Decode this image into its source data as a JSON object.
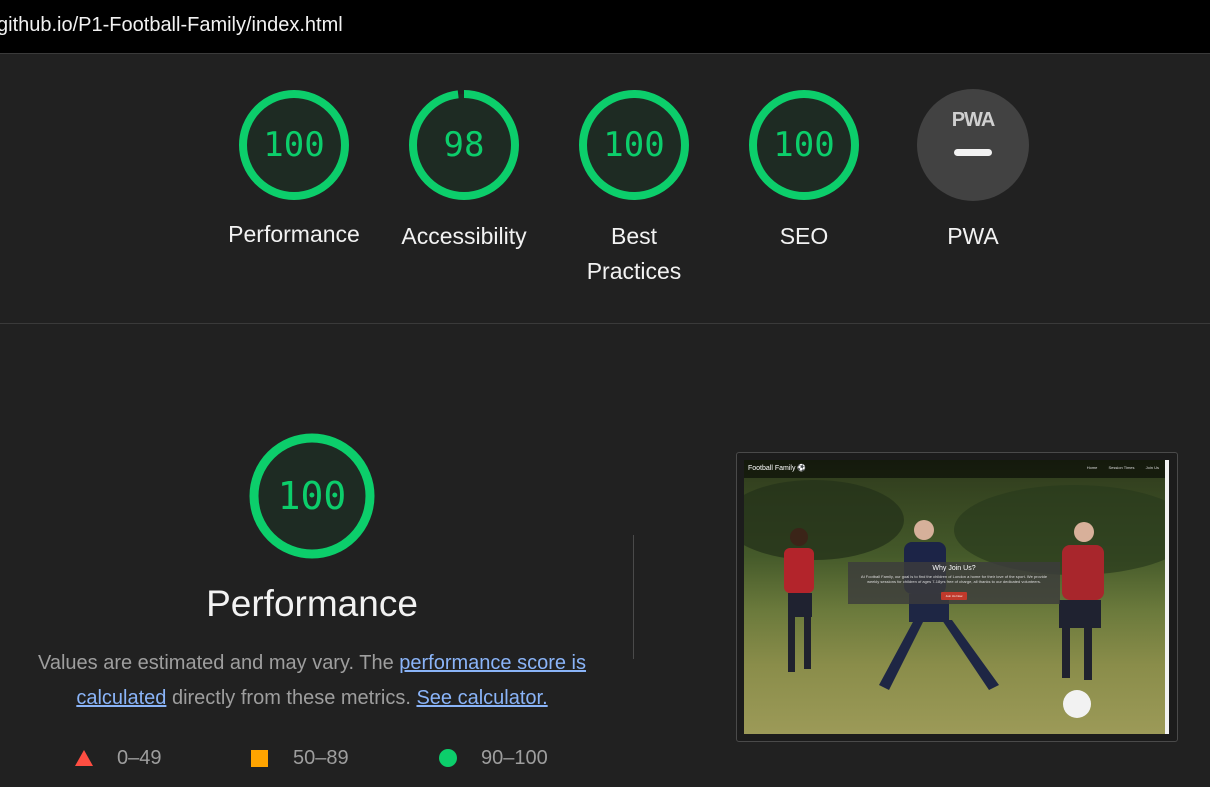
{
  "url": "github.io/P1-Football-Family/index.html",
  "colors": {
    "pass": "#0cce6b",
    "average": "#ffa400",
    "fail": "#ff4e42",
    "background": "#212121",
    "link": "#8ab4f8"
  },
  "gauges": [
    {
      "label": "Performance",
      "score": "100",
      "fraction": 1.0
    },
    {
      "label": "Accessibility",
      "score": "98",
      "fraction": 0.98
    },
    {
      "label": "Best Practices",
      "score": "100",
      "fraction": 1.0
    },
    {
      "label": "SEO",
      "score": "100",
      "fraction": 1.0
    },
    {
      "label": "PWA",
      "score": "",
      "icon": "pwa-badge-icon",
      "mark": "PWA"
    }
  ],
  "performance": {
    "score": "100",
    "fraction": 1.0,
    "title": "Performance",
    "description_prefix": "Values are estimated and may vary. The",
    "link_score": "performance score is calculated",
    "description_middle": "directly from these metrics.",
    "link_calculator": "See calculator."
  },
  "legend": [
    {
      "range": "0–49",
      "icon": "triangle-icon",
      "color": "#ff4e42"
    },
    {
      "range": "50–89",
      "icon": "square-icon",
      "color": "#ffa400"
    },
    {
      "range": "90–100",
      "icon": "circle-icon",
      "color": "#0cce6b"
    }
  ],
  "screenshot": {
    "brand": "Football Family ⚽",
    "nav_links": [
      "Home",
      "Session Times",
      "Join Us"
    ],
    "card_title": "Why Join Us?",
    "card_text": "At Football Family, our goal is to find the children of London a home for their love of the sport. We provide weekly sessions for children of ages 7-18yrs free of charge, all thanks to our dedicated volunteers.",
    "card_button": "Join Us Now"
  }
}
